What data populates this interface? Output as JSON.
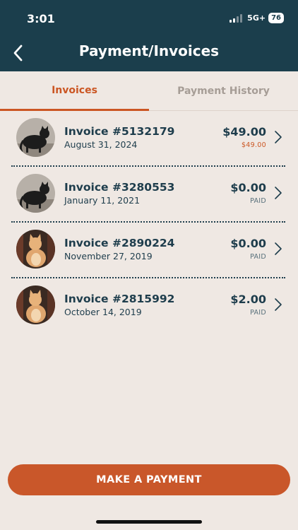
{
  "status_bar": {
    "time": "3:01",
    "network": "5G+",
    "battery": "76"
  },
  "header": {
    "title": "Payment/Invoices"
  },
  "tabs": [
    {
      "label": "Invoices",
      "active": true
    },
    {
      "label": "Payment History",
      "active": false
    }
  ],
  "invoices": [
    {
      "title": "Invoice #5132179",
      "date": "August 31, 2024",
      "amount": "$49.00",
      "status": "$49.00",
      "pet": "black-cat-photo"
    },
    {
      "title": "Invoice #3280553",
      "date": "January 11, 2021",
      "amount": "$0.00",
      "status": "PAID",
      "pet": "black-cat-photo"
    },
    {
      "title": "Invoice #2890224",
      "date": "November 27, 2019",
      "amount": "$0.00",
      "status": "PAID",
      "pet": "orange-cat-photo"
    },
    {
      "title": "Invoice #2815992",
      "date": "October 14, 2019",
      "amount": "$2.00",
      "status": "PAID",
      "pet": "orange-cat-photo"
    }
  ],
  "footer": {
    "pay_label": "MAKE A PAYMENT"
  },
  "colors": {
    "header_bg": "#1b3e4c",
    "accent": "#cb5623",
    "background": "#efe8e3",
    "text": "#1e3d4c"
  }
}
